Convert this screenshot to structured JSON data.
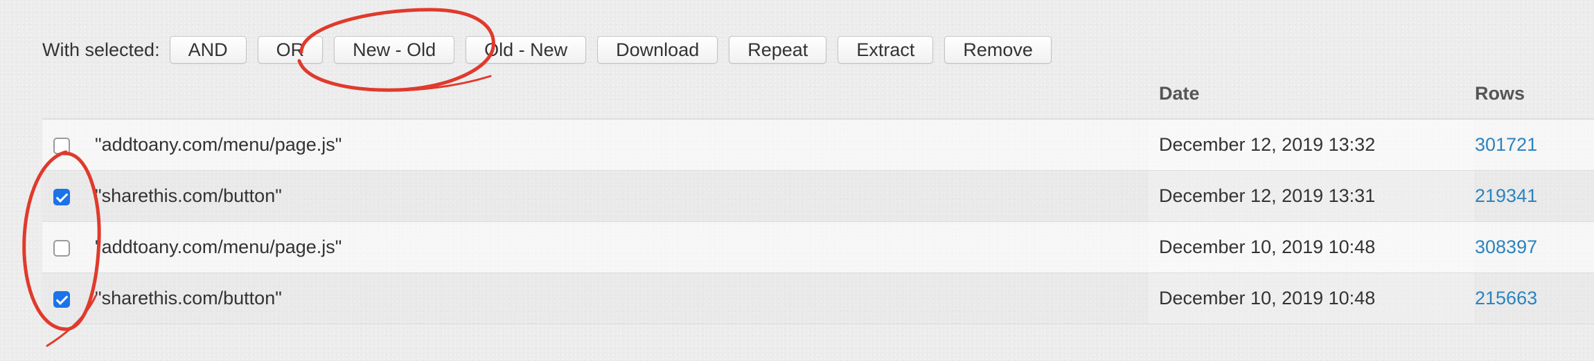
{
  "toolbar": {
    "label": "With selected:",
    "buttons": [
      {
        "label": "AND"
      },
      {
        "label": "OR"
      },
      {
        "label": "New - Old"
      },
      {
        "label": "Old - New"
      },
      {
        "label": "Download"
      },
      {
        "label": "Repeat"
      },
      {
        "label": "Extract"
      },
      {
        "label": "Remove"
      }
    ]
  },
  "table": {
    "columns": {
      "query": "",
      "date": "Date",
      "rows": "Rows"
    },
    "rows": [
      {
        "checked": false,
        "query": "\"addtoany.com/menu/page.js\"",
        "date": "December 12, 2019 13:32",
        "rows": "301721"
      },
      {
        "checked": true,
        "query": "\"sharethis.com/button\"",
        "date": "December 12, 2019 13:31",
        "rows": "219341"
      },
      {
        "checked": false,
        "query": "\"addtoany.com/menu/page.js\"",
        "date": "December 10, 2019 10:48",
        "rows": "308397"
      },
      {
        "checked": true,
        "query": "\"sharethis.com/button\"",
        "date": "December 10, 2019 10:48",
        "rows": "215663"
      }
    ]
  },
  "colors": {
    "checkbox_checked": "#1b73e8",
    "link": "#2b83be",
    "annotation": "#e03a2c"
  }
}
